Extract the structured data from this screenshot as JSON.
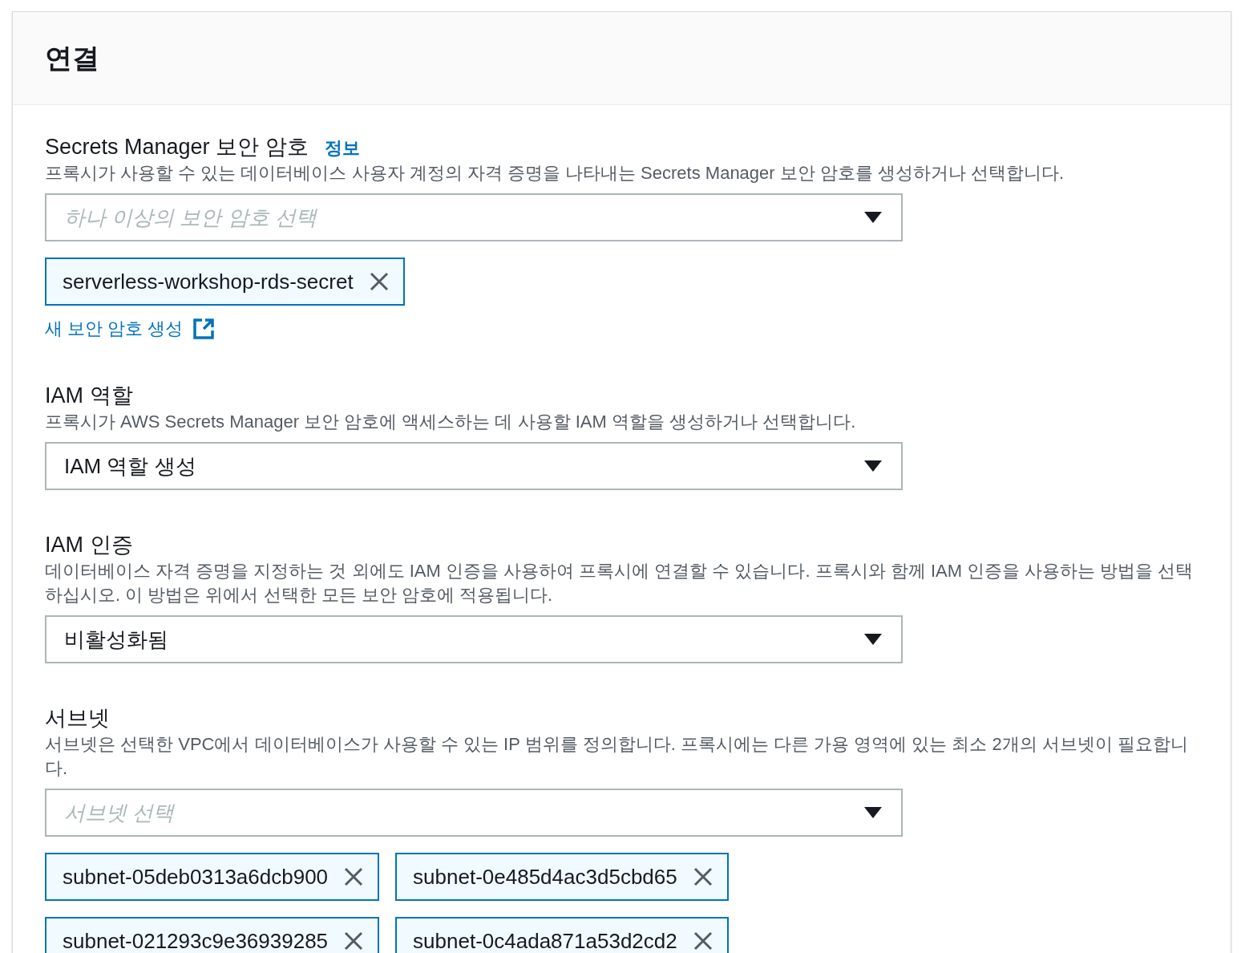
{
  "header": {
    "title": "연결"
  },
  "sections": [
    {
      "label": "Secrets Manager 보안 암호",
      "info": "정보",
      "description": "프록시가 사용할 수 있는 데이터베이스 사용자 계정의 자격 증명을 나타내는 Secrets Manager 보안 암호를 생성하거나 선택합니다.",
      "select": {
        "placeholder": "하나 이상의 보안 암호 선택"
      },
      "tokens": [
        "serverless-workshop-rds-secret"
      ],
      "link": "새 보안 암호 생성"
    },
    {
      "label": "IAM 역할",
      "description": "프록시가 AWS Secrets Manager 보안 암호에 액세스하는 데 사용할 IAM 역할을 생성하거나 선택합니다.",
      "select": {
        "value": "IAM 역할 생성"
      }
    },
    {
      "label": "IAM 인증",
      "description": "데이터베이스 자격 증명을 지정하는 것 외에도 IAM 인증을 사용하여 프록시에 연결할 수 있습니다. 프록시와 함께 IAM 인증을 사용하는 방법을 선택하십시오. 이 방법은 위에서 선택한 모든 보안 암호에 적용됩니다.",
      "select": {
        "value": "비활성화됨"
      }
    },
    {
      "label": "서브넷",
      "description": "서브넷은 선택한 VPC에서 데이터베이스가 사용할 수 있는 IP 범위를 정의합니다. 프록시에는 다른 가용 영역에 있는 최소 2개의 서브넷이 필요합니다.",
      "select": {
        "placeholder": "서브넷 선택"
      },
      "tokens": [
        "subnet-05deb0313a6dcb900",
        "subnet-0e485d4ac3d5cbd65",
        "subnet-021293c9e36939285",
        "subnet-0c4ada871a53d2cd2"
      ]
    }
  ]
}
